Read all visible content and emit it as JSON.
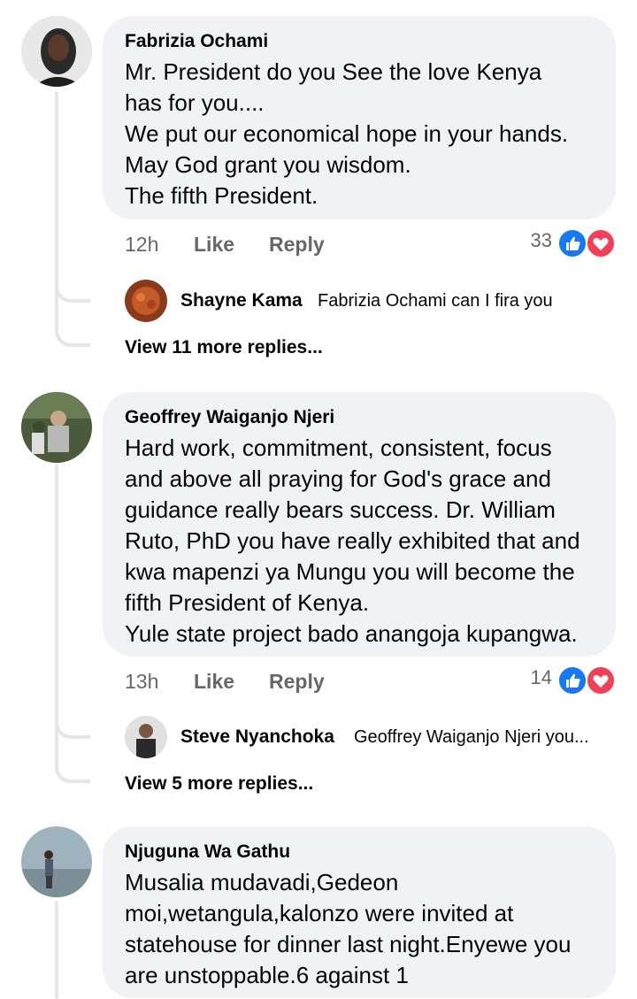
{
  "comments": [
    {
      "author": "Fabrizia Ochami",
      "text": "Mr. President do you See the love  Kenya\nhas for you....\nWe put our economical hope in your hands.\nMay God grant you wisdom.\nThe fifth President.",
      "time": "12h",
      "like_label": "Like",
      "reply_label": "Reply",
      "reaction_count": "33",
      "reply": {
        "author": "Shayne Kama",
        "text": "Fabrizia Ochami can I fira you"
      },
      "more_replies": "View 11 more replies..."
    },
    {
      "author": "Geoffrey Waiganjo Njeri",
      "text": "Hard work, commitment, consistent, focus\nand above all praying for God's grace and\nguidance really bears success. Dr. William\nRuto, PhD you have really exhibited that and\nkwa mapenzi ya Mungu you will become the\nfifth President of Kenya.\nYule state project bado anangoja kupangwa.",
      "time": "13h",
      "like_label": "Like",
      "reply_label": "Reply",
      "reaction_count": "14",
      "reply": {
        "author": "Steve Nyanchoka",
        "text": "Geoffrey Waiganjo Njeri you..."
      },
      "more_replies": "View 5 more replies..."
    },
    {
      "author": "Njuguna Wa Gathu",
      "text": "Musalia mudavadi,Gedeon\nmoi,wetangula,kalonzo were invited at\nstatehouse for dinner last night.Enyewe you\nare unstoppable.6 against 1"
    }
  ]
}
